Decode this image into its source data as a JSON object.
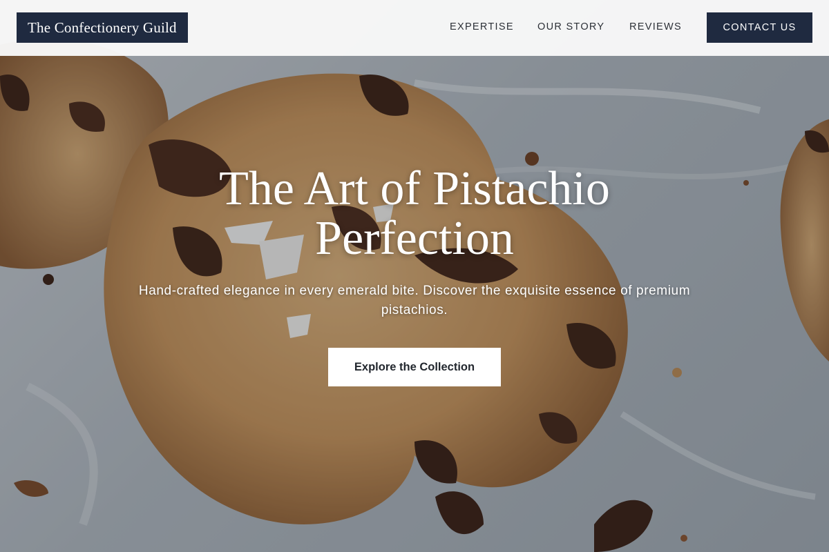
{
  "header": {
    "logo_text": "The Confectionery Guild",
    "nav": {
      "expertise": "EXPERTISE",
      "story": "OUR STORY",
      "reviews": "REVIEWS"
    },
    "contact_label": "CONTACT US"
  },
  "hero": {
    "title": "The Art of Pistachio Perfection",
    "subtitle": "Hand-crafted elegance in every emerald bite. Discover the exquisite essence of premium pistachios.",
    "cta_label": "Explore the Collection",
    "background_image": "chocolate-chip-cookie-photo"
  },
  "colors": {
    "brand_navy": "#1f2a40",
    "header_bg": "#f8f8f8",
    "nav_text": "#2b2f36",
    "hero_text": "#ffffff",
    "cta_bg": "#ffffff",
    "cta_text": "#22272e"
  }
}
